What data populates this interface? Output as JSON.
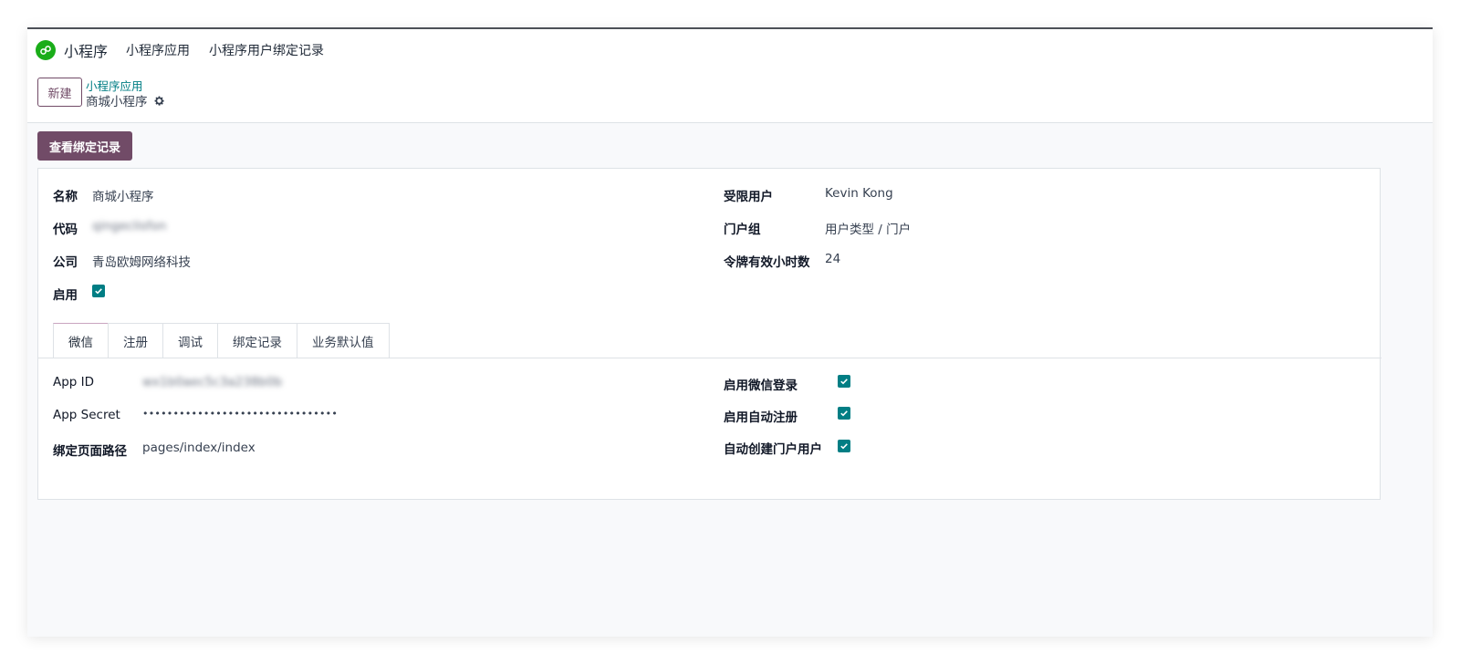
{
  "app": {
    "name": "小程序"
  },
  "menu": {
    "items": [
      "小程序应用",
      "小程序用户绑定记录"
    ]
  },
  "toolbar": {
    "new_label": "新建"
  },
  "breadcrumb": {
    "parent": "小程序应用",
    "current": "商城小程序"
  },
  "action": {
    "view_bindings_label": "查看绑定记录"
  },
  "form": {
    "left": [
      {
        "label": "名称",
        "value": "商城小程序"
      },
      {
        "label": "代码",
        "value": "qingeclisfon"
      },
      {
        "label": "公司",
        "value": "青岛欧姆网络科技"
      },
      {
        "label": "启用",
        "checked": true
      }
    ],
    "right": [
      {
        "label": "受限用户",
        "value": "Kevin Kong"
      },
      {
        "label": "门户组",
        "value": "用户类型 / 门户"
      },
      {
        "label": "令牌有效小时数",
        "value": "24"
      }
    ]
  },
  "tabs": [
    {
      "label": "微信",
      "active": true
    },
    {
      "label": "注册",
      "active": false
    },
    {
      "label": "调试",
      "active": false
    },
    {
      "label": "绑定记录",
      "active": false
    },
    {
      "label": "业务默认值",
      "active": false
    }
  ],
  "wechat": {
    "left": [
      {
        "label": "App ID",
        "value": "wx1b0aec5c3a238b0b"
      },
      {
        "label": "App Secret",
        "value": "••••••••••••••••••••••••••••••••"
      },
      {
        "label": "绑定页面路径",
        "value": "pages/index/index"
      }
    ],
    "right": [
      {
        "label": "启用微信登录",
        "checked": true
      },
      {
        "label": "启用自动注册",
        "checked": true
      },
      {
        "label": "自动创建门户用户",
        "checked": true
      }
    ]
  },
  "colors": {
    "primary": "#714b67",
    "accent": "#017e84",
    "wechat_green": "#1aad19"
  }
}
